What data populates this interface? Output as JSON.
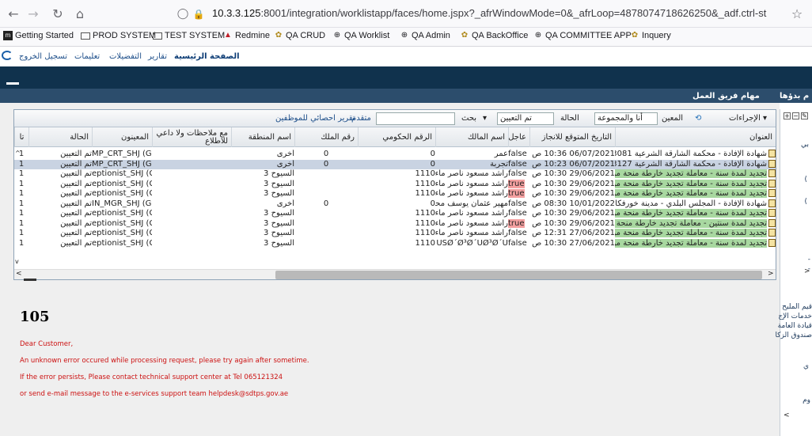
{
  "browser": {
    "url_host": "10.3.3.125",
    "url_rest": ":8001/integration/worklistapp/faces/home.jspx?_afrWindowMode=0&_afrLoop=4878074718626250&_adf.ctrl-st",
    "bookmarks": [
      {
        "label": "Getting Started",
        "icon": "firefox-icon"
      },
      {
        "label": "PROD SYSTEM",
        "icon": "folder-icon"
      },
      {
        "label": "TEST SYSTEM",
        "icon": "folder-icon"
      },
      {
        "label": "Redmine",
        "icon": "redmine-icon"
      },
      {
        "label": "QA CRUD",
        "icon": "emblem-icon"
      },
      {
        "label": "QA Worklist",
        "icon": "globe-icon"
      },
      {
        "label": "QA Admin",
        "icon": "globe-icon"
      },
      {
        "label": "QA BackOffice",
        "icon": "emblem-icon"
      },
      {
        "label": "QA COMMITTEE APP",
        "icon": "globe-icon"
      },
      {
        "label": "Inquery",
        "icon": "emblem-icon"
      }
    ]
  },
  "app_menu": {
    "home": "الصفحة الرئيسية",
    "reports": "تقارير",
    "preferences": "التفضيلات",
    "instructions": "تعليمات",
    "logout": "تسجيل الخروج"
  },
  "tabs": {
    "team_tasks": "مهام فريق العمل",
    "started": "م بدؤها"
  },
  "toolbar": {
    "actions": "الإجراءات",
    "assignee": "المعين",
    "assignee_value": "أنا والمجموعة",
    "status": "الحالة",
    "status_value": "تم التعيين",
    "search": "بحث",
    "advanced": "متقدم",
    "staff_report": "تقرير احصائي للموظفين"
  },
  "columns": {
    "title": "العنوان",
    "urgent": "عاجل",
    "expected_date": "التاريخ المتوقع للانجاز",
    "owner": "اسم المالك",
    "gov_no": "الرقم الحكومي",
    "property_no": "رقم الملك",
    "area": "اسم المنطقة",
    "notes": "مع ملاحظات ولا داعي للاطلاع",
    "assignees": "المعينون",
    "status": "الحالة",
    "extra": "تا"
  },
  "rows": [
    {
      "title": "شهادة الإفادة - محكمة الشارقة الشرعية 83081",
      "title_hl": "",
      "urgent": "false",
      "date": "06/07/2021 10:36 ص",
      "owner": "عمر",
      "gov": "0",
      "prop": "0",
      "area": "أخرى",
      "assignee": "MP_CRT_SHJ (G)",
      "status": "تم التعيين",
      "extra": "1"
    },
    {
      "title": "شهادة الإفادة - محكمة الشارقة الشرعية 83127",
      "title_hl": "",
      "urgent": "false",
      "date": "06/07/2021 10:23 ص",
      "owner": "تجربة",
      "gov": "0",
      "prop": "0",
      "area": "أخرى",
      "assignee": "MP_CRT_SHJ (G)",
      "status": "تم التعيين",
      "extra": "1"
    },
    {
      "title": "تجديد لمدة سنة - معاملة تجديد خارطة منحة مؤقتة",
      "title_hl": "green",
      "urgent": "false",
      "date": "29/06/2021 10:30 ص",
      "owner": "راشد مسعود ناصر ماء",
      "gov": "1110",
      "prop": "",
      "area": "السيوح 3",
      "assignee": "eptionist_SHJ (G)",
      "status": "تم التعيين",
      "extra": "1"
    },
    {
      "title": "تجديد لمدة سنة - معاملة تجديد خارطة منحة مؤقتة",
      "title_hl": "green",
      "urgent": "true",
      "date": "29/06/2021 10:30 ص",
      "owner": "راشد مسعود ناصر ماء",
      "gov": "1110",
      "prop": "",
      "area": "السيوح 3",
      "assignee": "eptionist_SHJ (G)",
      "status": "تم التعيين",
      "extra": "1"
    },
    {
      "title": "تجديد لمدة سنة - معاملة تجديد خارطة منحة مؤقتة",
      "title_hl": "green",
      "urgent": "true",
      "date": "29/06/2021 10:30 ص",
      "owner": "راشد مسعود ناصر ماء",
      "gov": "1110",
      "prop": "",
      "area": "السيوح 3",
      "assignee": "eptionist_SHJ (G)",
      "status": "تم التعيين",
      "extra": "1"
    },
    {
      "title": "شهادة الإفادة - المجلس البلدي - مدينة خورفكان",
      "title_hl": "",
      "urgent": "false",
      "date": "10/01/2022 08:30 ص",
      "owner": "مهير عثمان يوسف محـ",
      "gov": "0",
      "prop": "0",
      "area": "أخرى",
      "assignee": "IN_MGR_SHJ (G)",
      "status": "تم التعيين",
      "extra": "1"
    },
    {
      "title": "تجديد لمدة سنة - معاملة تجديد خارطة منحة مؤقتة",
      "title_hl": "green",
      "urgent": "false",
      "date": "29/06/2021 10:30 ص",
      "owner": "راشد مسعود ناصر ماء",
      "gov": "1110",
      "prop": "",
      "area": "السيوح 3",
      "assignee": "eptionist_SHJ (G)",
      "status": "تم التعيين",
      "extra": "1"
    },
    {
      "title": "تجديد لمدة سنتين - معاملة تجديد خارطة منحة م",
      "title_hl": "green",
      "urgent": "true",
      "date": "29/06/2021 10:30 ص",
      "owner": "راشد مسعود ناصر ماء",
      "gov": "1110",
      "prop": "",
      "area": "السيوح 3",
      "assignee": "eptionist_SHJ (G)",
      "status": "تم التعيين",
      "extra": "1"
    },
    {
      "title": "تجديد لمدة سنة - معاملة تجديد خارطة منحة مؤقتة",
      "title_hl": "green",
      "urgent": "false",
      "date": "27/06/2021 12:31 ص",
      "owner": "راشد مسعود ناصر ماء",
      "gov": "1110",
      "prop": "",
      "area": "السيوح 3",
      "assignee": "eptionist_SHJ (G)",
      "status": "تم التعيين",
      "extra": "1"
    },
    {
      "title": "تجديد لمدة سنة - معاملة تجديد خارطة منحة مؤقتة",
      "title_hl": "green",
      "urgent": "false",
      "date": "27/06/2021 10:30 ص",
      "owner": "ÙŠØ´Ø³Ø´ÙØ³Ø´Ù",
      "gov": "1110",
      "prop": "",
      "area": "السيوح 3",
      "assignee": "eptionist_SHJ (G)",
      "status": "تم التعيين",
      "extra": "1"
    }
  ],
  "error": {
    "code": "105",
    "line1": "Dear Customer,",
    "line2": "An unknown error occured while processing request, please try again after sometime.",
    "line3": "If the error persists, Please contact technical support center at Tel 065121324",
    "line4": "or send e-mail message to the e-services support team helpdesk@sdtps.gov.ae"
  },
  "right_panel": {
    "t1": "بي",
    "t2": ")",
    "t3": ")",
    "t4": "قيم المليح",
    "t5": "خدمات الإج",
    "t6": "قيادة العامة",
    "t7": "صندوق الزكا",
    "t8": "ي",
    "t9": "وم"
  },
  "colors": {
    "nav": "#10324d",
    "tabband": "#2c4d6c",
    "green": "#a8d8a0",
    "red": "#f4a0a0",
    "error": "#cc1111"
  }
}
